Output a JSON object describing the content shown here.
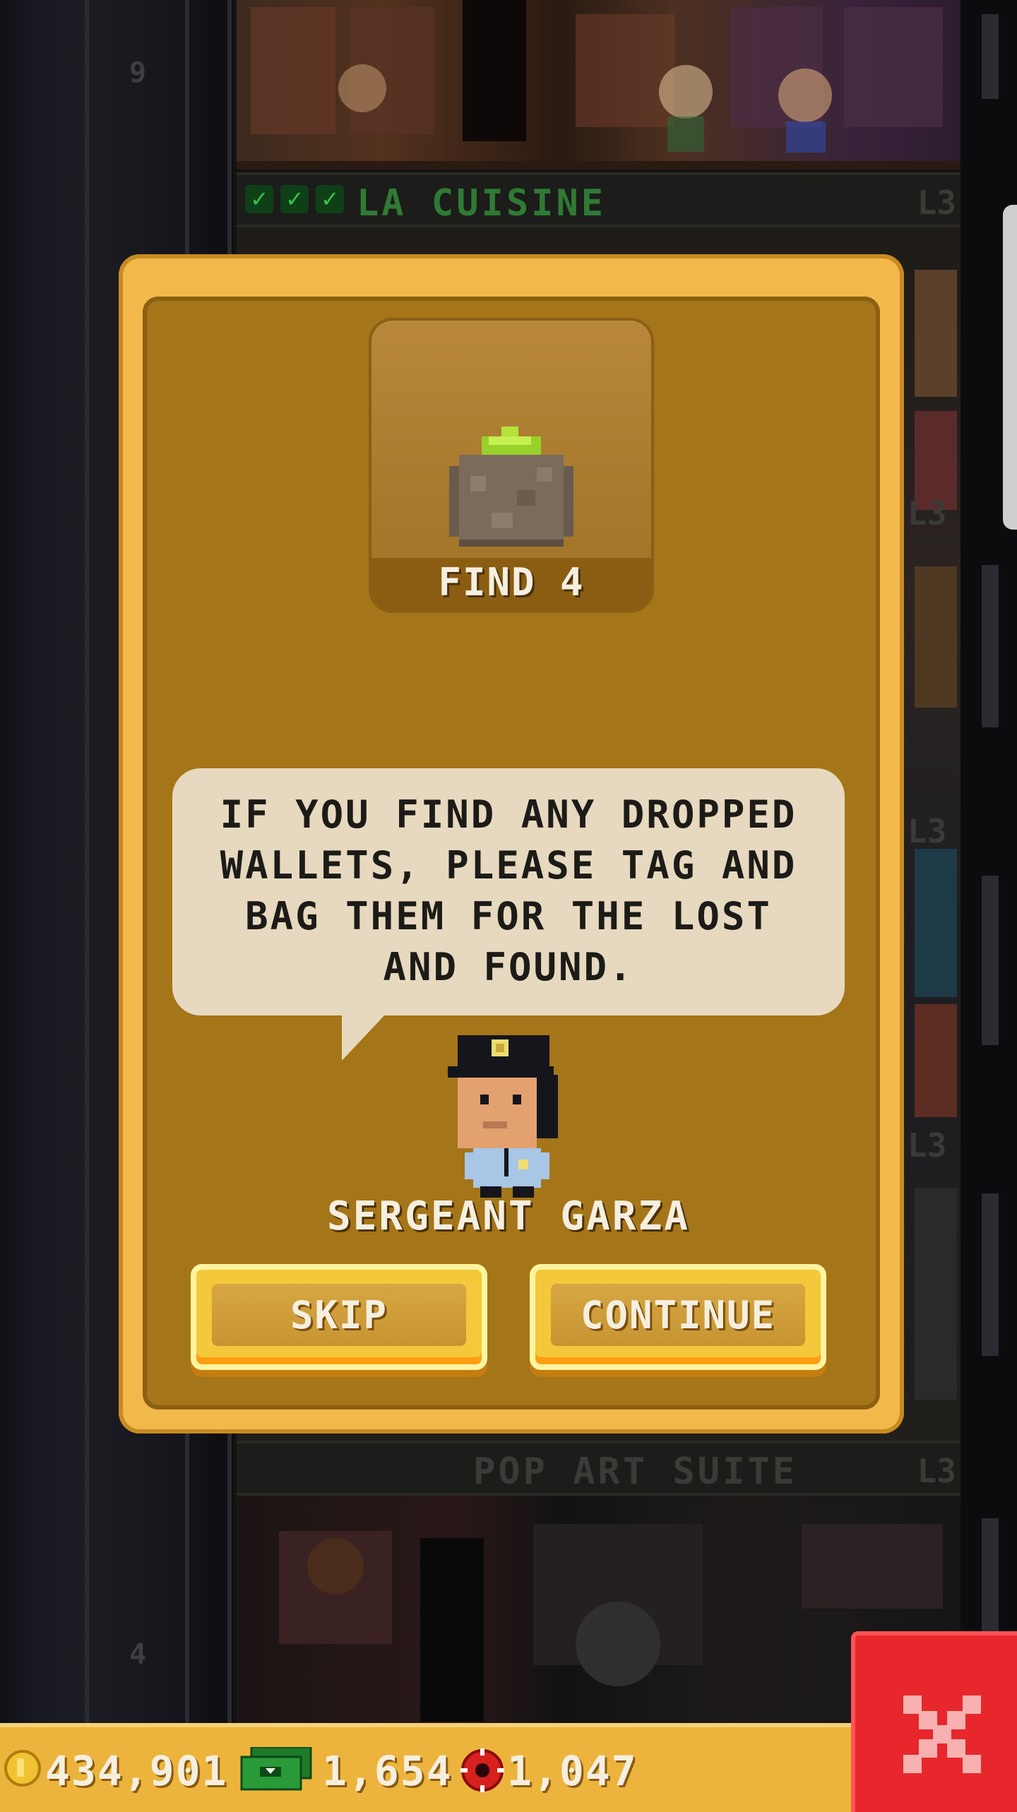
{
  "background": {
    "floor_numbers": [
      "9",
      "4"
    ],
    "floors": [
      {
        "name": "LA CUISINE",
        "level": "L3",
        "checks": 3,
        "name_color": "#2f7a34"
      },
      {
        "name": "POP ART SUITE",
        "level": "L3",
        "checks": 0,
        "name_color": "#3a3a36"
      }
    ],
    "side_levels": [
      "L3",
      "L3",
      "L3",
      "L3"
    ]
  },
  "dialog": {
    "goal": {
      "label": "FIND 4",
      "item_icon": "potted-plant-icon"
    },
    "speech": "IF YOU FIND ANY DROPPED WALLETS, PLEASE TAG AND BAG THEM FOR THE LOST AND FOUND.",
    "npc_name": "SERGEANT GARZA",
    "buttons": {
      "skip": "SKIP",
      "continue": "CONTINUE"
    }
  },
  "currency": {
    "coins": "434,901",
    "bux": "1,654",
    "tokens": "1,047"
  },
  "colors": {
    "dialog_border": "#f2b94a",
    "dialog_fill": "#a57519",
    "speech_bubble": "#e6d9bf",
    "close_button": "#e7272b",
    "currency_bar": "#ecb43c"
  }
}
